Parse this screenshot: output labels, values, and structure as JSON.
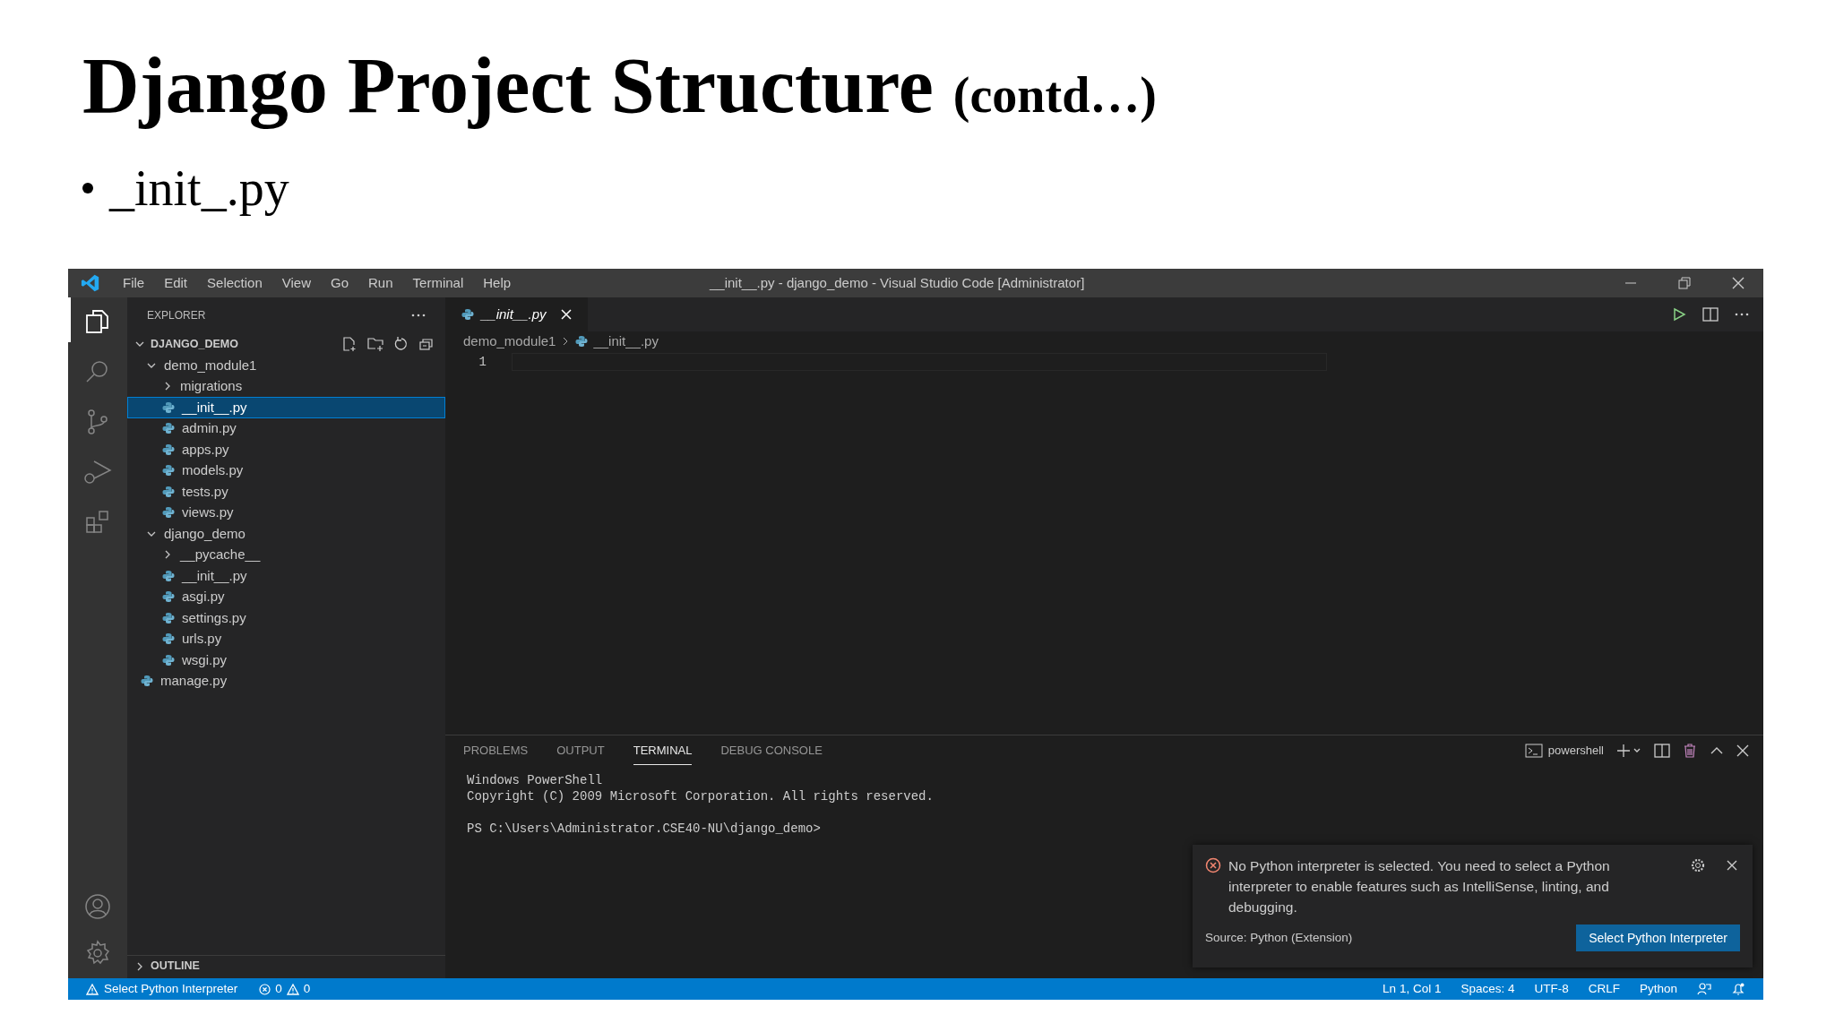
{
  "slide": {
    "title": "Django Project Structure",
    "title_suffix": "(contd…)",
    "bullets": [
      "_init_.py"
    ]
  },
  "window": {
    "title": "__init__.py - django_demo - Visual Studio Code [Administrator]",
    "menu": [
      "File",
      "Edit",
      "Selection",
      "View",
      "Go",
      "Run",
      "Terminal",
      "Help"
    ]
  },
  "explorer": {
    "header": "EXPLORER",
    "root": {
      "label": "DJANGO_DEMO",
      "expanded": true
    },
    "tree": [
      {
        "kind": "folder",
        "label": "demo_module1",
        "expanded": true,
        "children": [
          {
            "kind": "folder",
            "label": "migrations",
            "expanded": false
          },
          {
            "kind": "file",
            "label": "__init__.py",
            "selected": true
          },
          {
            "kind": "file",
            "label": "admin.py",
            "selected": false
          },
          {
            "kind": "file",
            "label": "apps.py",
            "selected": false
          },
          {
            "kind": "file",
            "label": "models.py",
            "selected": false
          },
          {
            "kind": "file",
            "label": "tests.py",
            "selected": false
          },
          {
            "kind": "file",
            "label": "views.py",
            "selected": false
          }
        ]
      },
      {
        "kind": "folder",
        "label": "django_demo",
        "expanded": true,
        "children": [
          {
            "kind": "folder",
            "label": "__pycache__",
            "expanded": false
          },
          {
            "kind": "file",
            "label": "__init__.py",
            "selected": false
          },
          {
            "kind": "file",
            "label": "asgi.py",
            "selected": false
          },
          {
            "kind": "file",
            "label": "settings.py",
            "selected": false
          },
          {
            "kind": "file",
            "label": "urls.py",
            "selected": false
          },
          {
            "kind": "file",
            "label": "wsgi.py",
            "selected": false
          }
        ]
      },
      {
        "kind": "file",
        "label": "manage.py",
        "selected": false
      }
    ],
    "outline": {
      "label": "OUTLINE",
      "expanded": false
    }
  },
  "editor": {
    "tab": "__init__.py",
    "breadcrumb": [
      "demo_module1",
      "__init__.py"
    ],
    "line_numbers": [
      "1"
    ]
  },
  "panel": {
    "tabs": [
      {
        "label": "PROBLEMS",
        "selected": false
      },
      {
        "label": "OUTPUT",
        "selected": false
      },
      {
        "label": "TERMINAL",
        "selected": true
      },
      {
        "label": "DEBUG CONSOLE",
        "selected": false
      }
    ],
    "shell": "powershell",
    "terminal_blocks": [
      [
        "Windows PowerShell",
        "Copyright (C) 2009 Microsoft Corporation. All rights reserved."
      ],
      [
        "PS C:\\Users\\Administrator.CSE40-NU\\django_demo>"
      ]
    ]
  },
  "notification": {
    "message": "No Python interpreter is selected. You need to select a Python interpreter to enable features such as IntelliSense, linting, and debugging.",
    "source": "Source: Python (Extension)",
    "button": "Select Python Interpreter"
  },
  "status_bar": {
    "left": [
      {
        "kind": "warning-text",
        "text": "Select Python Interpreter"
      },
      {
        "kind": "problems",
        "errors": "0",
        "warnings": "0"
      }
    ],
    "right": [
      "Ln 1, Col 1",
      "Spaces: 4",
      "UTF-8",
      "CRLF",
      "Python"
    ]
  }
}
